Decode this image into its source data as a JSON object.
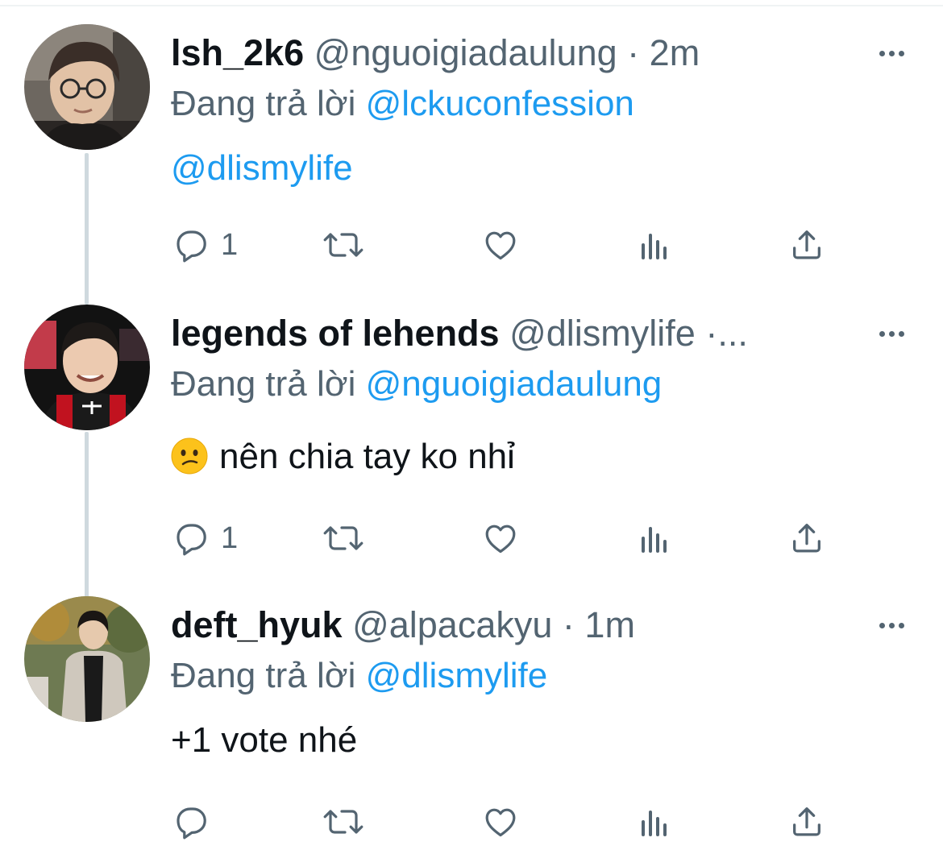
{
  "tweets": [
    {
      "name": "lsh_2k6",
      "handle": "@nguoigiadaulung",
      "separator": "·",
      "time": "2m",
      "reply_prefix": "Đang trả lời",
      "reply_to": "@lckuconfession",
      "content_mention": "@dlismylife",
      "reply_count": "1"
    },
    {
      "name": "legends of lehends",
      "handle": "@dlismylife",
      "separator": "·...",
      "time": "",
      "reply_prefix": "Đang trả lời",
      "reply_to": "@nguoigiadaulung",
      "content_text": "nên chia tay ko nhỉ",
      "reply_count": "1"
    },
    {
      "name": "deft_hyuk",
      "handle": "@alpacakyu",
      "separator": "·",
      "time": "1m",
      "reply_prefix": "Đang trả lời",
      "reply_to": "@dlismylife",
      "content_text": "+1 vote nhé",
      "reply_count": ""
    }
  ],
  "icons": {
    "reply": "reply-icon",
    "retweet": "retweet-icon",
    "like": "like-icon",
    "views": "views-icon",
    "share": "share-icon",
    "more": "more-icon",
    "emoji": "confused-face-emoji"
  },
  "colors": {
    "accent": "#1d9bf0",
    "secondary_text": "#536471",
    "primary_text": "#0f1419",
    "thread_line": "#cfd9de"
  }
}
